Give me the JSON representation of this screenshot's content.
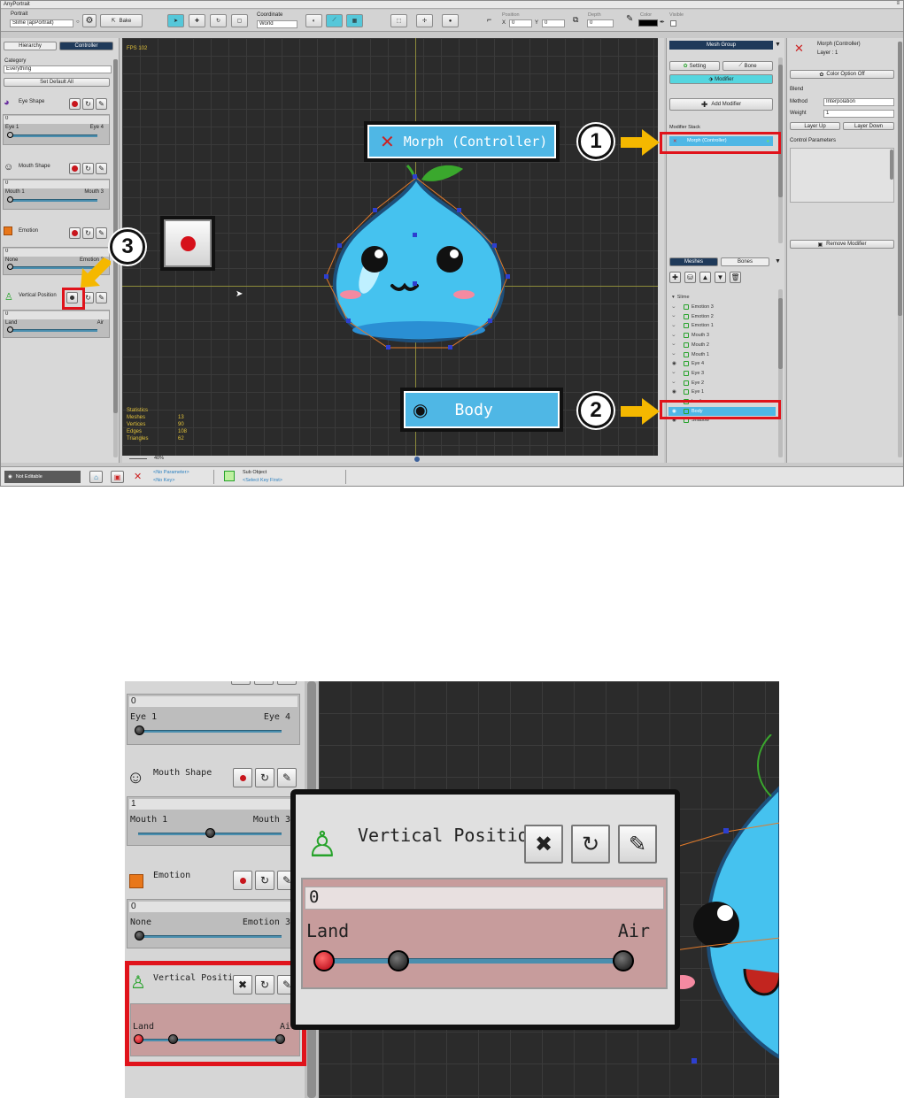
{
  "app": {
    "title": "AnyPortrait"
  },
  "toolbar": {
    "portrait_label": "Portrait",
    "portrait_value": "Slime (apPortrait)",
    "bake": "Bake",
    "coordinate_label": "Coordinate",
    "coordinate_value": "World",
    "position_label": "Position",
    "x_label": "X",
    "x_value": "0",
    "y_label": "Y",
    "y_value": "0",
    "depth_label": "Depth",
    "depth_value": "0",
    "color_label": "Color",
    "visible_label": "Visible"
  },
  "left_panel": {
    "tabs": [
      "Hierarchy",
      "Controller"
    ],
    "category_label": "Category",
    "category_value": "Everything",
    "set_default": "Set Default All",
    "params": [
      {
        "name": "Eye Shape",
        "value": "0",
        "min": "Eye 1",
        "max": "Eye 4"
      },
      {
        "name": "Mouth Shape",
        "value": "0",
        "min": "Mouth 1",
        "max": "Mouth 3"
      },
      {
        "name": "Emotion",
        "value": "0",
        "min": "None",
        "max": "Emotion 3"
      },
      {
        "name": "Vertical Position",
        "value": "0",
        "min": "Land",
        "max": "Air"
      }
    ]
  },
  "viewport": {
    "fps": "FPS 102",
    "stats_title": "Statistics",
    "stats": [
      [
        "Meshes",
        "13"
      ],
      [
        "Vertices",
        "90"
      ],
      [
        "Edges",
        "108"
      ],
      [
        "Triangles",
        "62"
      ]
    ],
    "zoom": "40%",
    "callout_morph": "Morph (Controller)",
    "callout_body": "Body"
  },
  "mesh_group_panel": {
    "title": "Mesh Group",
    "setting": "Setting",
    "bone": "Bone",
    "modifier": "Modifier",
    "add_modifier": "Add Modifier",
    "modifier_stack_label": "Modifier Stack",
    "modifier_item": "Morph (Controller)",
    "tabs": [
      "Meshes",
      "Bones"
    ],
    "root": "Slime",
    "meshes": [
      "Emotion 3",
      "Emotion 2",
      "Emotion 1",
      "Mouth 3",
      "Mouth 2",
      "Mouth 1",
      "Eye 4",
      "Eye 3",
      "Eye 2",
      "Eye 1",
      "Leaf",
      "Body",
      "Shadow"
    ]
  },
  "right_panel": {
    "modifier_name": "Morph (Controller)",
    "layer": "Layer : 1",
    "color_option": "Color Option Off",
    "blend_label": "Blend",
    "method_label": "Method",
    "method_value": "Interpolation",
    "weight_label": "Weight",
    "weight_value": "1",
    "layer_up": "Layer Up",
    "layer_down": "Layer Down",
    "control_params_label": "Control Parameters",
    "remove_modifier": "Remove Modifier"
  },
  "statusbar": {
    "not_editable": "Not Editable",
    "no_parameter": "<No Parameter>",
    "no_key": "<No Key>",
    "sub_object": "Sub Object",
    "select_key": "<Select Key First>"
  },
  "callouts": {
    "n1": "1",
    "n2": "2",
    "n3": "3"
  },
  "zoom_detail": {
    "eye1": "Eye 1",
    "eye4": "Eye 4",
    "eye_value": "0",
    "mouth_shape": "Mouth Shape",
    "mouth_value": "1",
    "mouth1": "Mouth 1",
    "mouth3": "Mouth 3",
    "emotion": "Emotion",
    "emotion_value": "0",
    "none": "None",
    "emotion3": "Emotion 3",
    "vertical_position": "Vertical Position",
    "vp_value": "0",
    "land": "Land",
    "air": "Air"
  },
  "colors": {
    "accent": "#4fb7e5",
    "highlight": "#e0131b",
    "callout_arrow": "#f5b800",
    "panel": "#d6d6d6",
    "viewport": "#2b2b2b",
    "slider_track": "#4a8eae",
    "record": "#c8161d",
    "param_bg": "#c79c9c"
  }
}
